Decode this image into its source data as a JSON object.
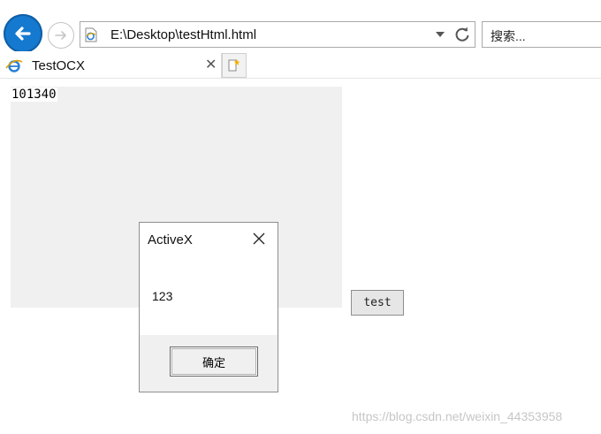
{
  "browser": {
    "address": "E:\\Desktop\\testHtml.html",
    "search_placeholder": "搜索...",
    "tab_title": "TestOCX"
  },
  "page": {
    "ocx_value": "101340",
    "test_button_label": "test"
  },
  "dialog": {
    "title": "ActiveX",
    "message": "123",
    "ok_label": "确定"
  },
  "watermark": "https://blog.csdn.net/weixin_44353958",
  "colors": {
    "back_button": "#1579cf",
    "ocx_background": "#f0f0f0",
    "dialog_footer": "#f0f0f0"
  },
  "icons": [
    "back-arrow-icon",
    "forward-arrow-icon",
    "ie-page-icon",
    "dropdown-arrow-icon",
    "refresh-icon",
    "close-icon",
    "new-tab-icon"
  ]
}
